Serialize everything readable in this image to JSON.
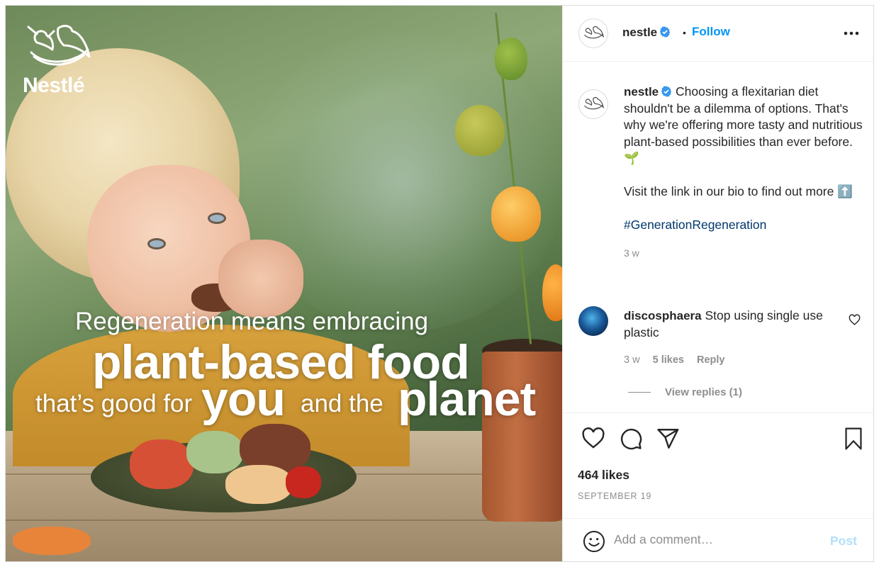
{
  "media": {
    "logo_text": "Nestlé",
    "overlay": {
      "line1": "Regeneration means embracing",
      "line2": "plant-based food",
      "line3a": "that’s good for",
      "line3b": "you",
      "line3c": "and the",
      "line3d": "planet"
    }
  },
  "header": {
    "username": "nestle",
    "separator": "•",
    "follow_label": "Follow",
    "more_icon": "more-horizontal-icon"
  },
  "caption": {
    "username": "nestle",
    "text": "Choosing a flexitarian diet shouldn't be a dilemma of options. That's why we're offering more tasty and nutritious plant-based possibilities than ever before. 🌱",
    "line2": "Visit the link in our bio to find out more ⬆️",
    "hashtag": "#GenerationRegeneration",
    "time": "3 w"
  },
  "comment": {
    "username": "discosphaera",
    "text": "Stop using single use plastic",
    "time": "3 w",
    "likes": "5 likes",
    "reply_label": "Reply",
    "view_replies": "View replies (1)"
  },
  "actions": {
    "likes": "464 likes",
    "date": "SEPTEMBER 19"
  },
  "add_comment": {
    "placeholder": "Add a comment…",
    "post_label": "Post"
  },
  "colors": {
    "accent": "#0095f6",
    "verified": "#3897f0",
    "hashtag": "#00376b",
    "muted": "#8e8e8e",
    "post_disabled": "#b2dffc"
  }
}
